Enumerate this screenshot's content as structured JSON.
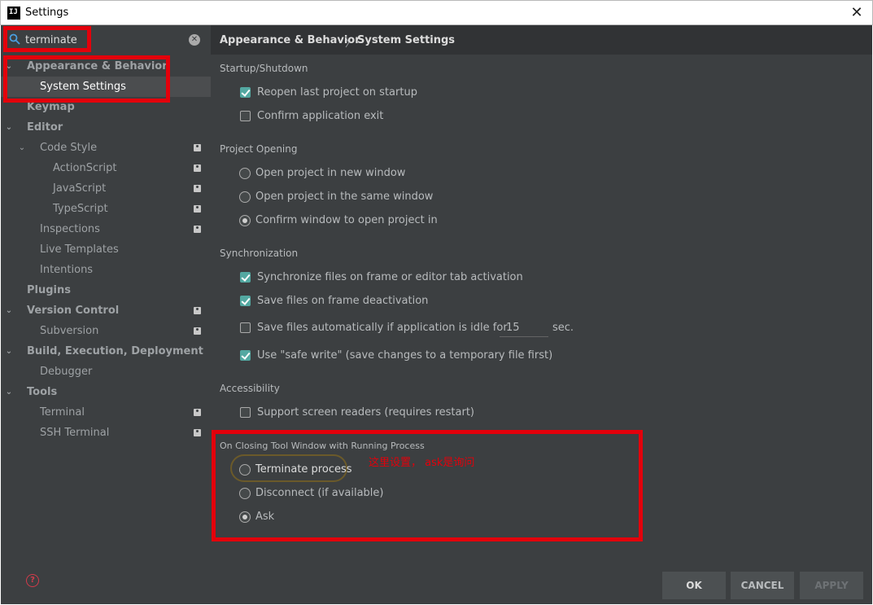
{
  "window": {
    "title": "Settings",
    "app_icon": "IJ"
  },
  "search": {
    "value": "terminate",
    "placeholder": ""
  },
  "tree": [
    {
      "label": "Appearance & Behavior",
      "level": 0,
      "expanded": true,
      "bold": true
    },
    {
      "label": "System Settings",
      "level": 1,
      "selected": true
    },
    {
      "label": "Keymap",
      "level": 0,
      "bold": true
    },
    {
      "label": "Editor",
      "level": 0,
      "expanded": true,
      "bold": true
    },
    {
      "label": "Code Style",
      "level": 1,
      "expanded": true,
      "project_icon": true
    },
    {
      "label": "ActionScript",
      "level": 2,
      "project_icon": true
    },
    {
      "label": "JavaScript",
      "level": 2,
      "project_icon": true
    },
    {
      "label": "TypeScript",
      "level": 2,
      "project_icon": true
    },
    {
      "label": "Inspections",
      "level": 1,
      "project_icon": true
    },
    {
      "label": "Live Templates",
      "level": 1
    },
    {
      "label": "Intentions",
      "level": 1
    },
    {
      "label": "Plugins",
      "level": 0,
      "bold": true
    },
    {
      "label": "Version Control",
      "level": 0,
      "expanded": true,
      "bold": true,
      "project_icon": true
    },
    {
      "label": "Subversion",
      "level": 1,
      "project_icon": true
    },
    {
      "label": "Build, Execution, Deployment",
      "level": 0,
      "expanded": true,
      "bold": true
    },
    {
      "label": "Debugger",
      "level": 1
    },
    {
      "label": "Tools",
      "level": 0,
      "expanded": true,
      "bold": true
    },
    {
      "label": "Terminal",
      "level": 1,
      "project_icon": true
    },
    {
      "label": "SSH Terminal",
      "level": 1,
      "project_icon": true
    }
  ],
  "breadcrumb": {
    "parent": "Appearance & Behavior",
    "separator": "〉",
    "current": "System Settings"
  },
  "sections": {
    "startup": {
      "title": "Startup/Shutdown",
      "reopen": {
        "label": "Reopen last project on startup",
        "checked": true
      },
      "confirm_exit": {
        "label": "Confirm application exit",
        "checked": false
      }
    },
    "opening": {
      "title": "Project Opening",
      "new_window": {
        "label": "Open project in new window",
        "selected": false
      },
      "same_window": {
        "label": "Open project in the same window",
        "selected": false
      },
      "confirm_window": {
        "label": "Confirm window to open project in",
        "selected": true
      }
    },
    "sync": {
      "title": "Synchronization",
      "sync_files": {
        "label": "Synchronize files on frame or editor tab activation",
        "checked": true
      },
      "save_deactivation": {
        "label": "Save files on frame deactivation",
        "checked": true
      },
      "save_idle": {
        "label": "Save files automatically if application is idle for",
        "checked": false,
        "value": "15",
        "unit": "sec."
      },
      "safe_write": {
        "label": "Use \"safe write\" (save changes to a temporary file first)",
        "checked": true
      }
    },
    "accessibility": {
      "title": "Accessibility",
      "screen_readers": {
        "label": "Support screen readers (requires restart)",
        "checked": false
      }
    },
    "closing": {
      "title": "On Closing Tool Window with Running Process",
      "terminate": {
        "label": "Terminate process",
        "selected": false
      },
      "disconnect": {
        "label": "Disconnect (if available)",
        "selected": false
      },
      "ask": {
        "label": "Ask",
        "selected": true
      }
    }
  },
  "annotation": {
    "text": "这里设置， ask是询问",
    "color": "#e3000b"
  },
  "buttons": {
    "ok": "OK",
    "cancel": "CANCEL",
    "apply": "APPLY"
  },
  "colors": {
    "background": "#3c3f41",
    "selection": "#4b4d4f",
    "checkbox_checked": "#53a8a1",
    "annotation": "#e3000b"
  }
}
